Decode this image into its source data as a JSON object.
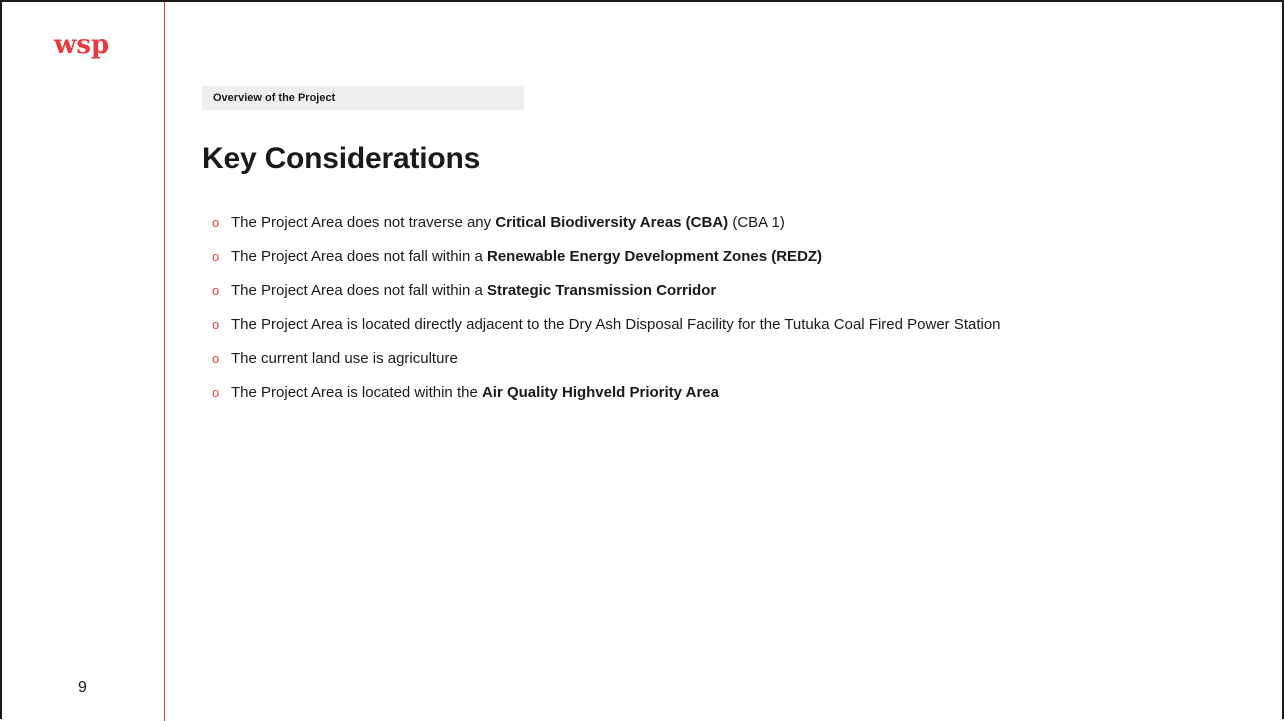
{
  "brand": {
    "logo_text": "wsp",
    "accent_color": "#e8393c"
  },
  "slide": {
    "page_number": "9",
    "section_tag": "Overview of the Project",
    "title": "Key Considerations",
    "bullet_glyph": "o",
    "bullets": [
      {
        "before": "The Project Area does not traverse any ",
        "bold": "Critical Biodiversity Areas (CBA)",
        "after": " (CBA 1)"
      },
      {
        "before": "The Project Area does not fall within a ",
        "bold": "Renewable Energy Development Zones (REDZ)",
        "after": ""
      },
      {
        "before": "The Project Area does not fall within a ",
        "bold": "Strategic Transmission Corridor",
        "after": ""
      },
      {
        "before": "The Project Area is located directly adjacent to the Dry Ash Disposal Facility for the Tutuka Coal Fired Power Station",
        "bold": "",
        "after": ""
      },
      {
        "before": "The current land use is agriculture",
        "bold": "",
        "after": ""
      },
      {
        "before": "The Project Area is located within the ",
        "bold": "Air Quality Highveld Priority Area",
        "after": ""
      }
    ]
  }
}
